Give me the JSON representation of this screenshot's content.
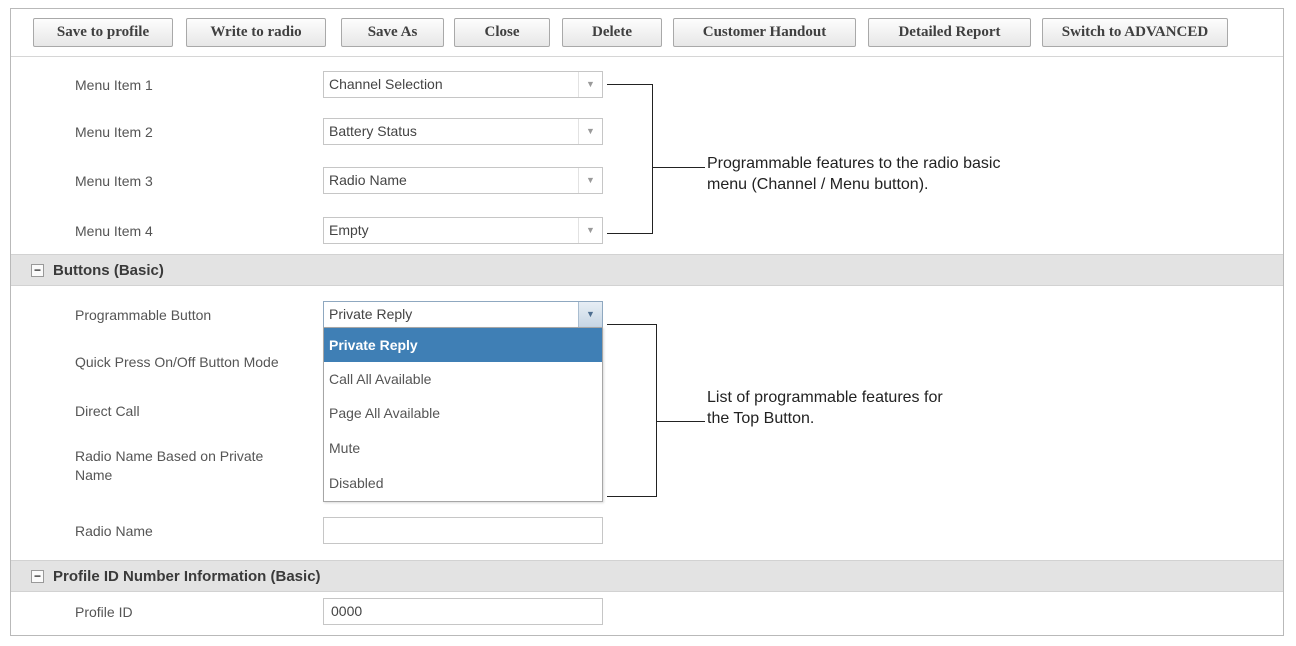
{
  "toolbar": {
    "buttons": [
      "Save to profile",
      "Write to radio",
      "Save As",
      "Close",
      "Delete",
      "Customer Handout",
      "Detailed Report",
      "Switch to ADVANCED"
    ]
  },
  "menu_items": [
    {
      "label": "Menu Item 1",
      "value": "Channel Selection"
    },
    {
      "label": "Menu Item 2",
      "value": "Battery Status"
    },
    {
      "label": "Menu Item 3",
      "value": "Radio Name"
    },
    {
      "label": "Menu Item 4",
      "value": "Empty"
    }
  ],
  "annotations": {
    "menu_line1": "Programmable features to the radio basic",
    "menu_line2": "menu (Channel / Menu button).",
    "button_line1": "List of programmable features for",
    "button_line2": "the Top Button."
  },
  "buttons_section": {
    "title": "Buttons (Basic)",
    "toggle": "−",
    "programmable_label": "Programmable Button",
    "programmable_value": "Private Reply",
    "quick_press_label": "Quick Press On/Off Button Mode",
    "direct_call_label": "Direct Call",
    "radio_name_private_label_1": "Radio Name Based on Private",
    "radio_name_private_label_2": "Name",
    "radio_name_label": "Radio Name",
    "radio_name_value": ""
  },
  "dropdown_options": [
    {
      "label": "Private Reply",
      "selected": true
    },
    {
      "label": "Call All Available",
      "selected": false
    },
    {
      "label": "Page All Available",
      "selected": false
    },
    {
      "label": "Mute",
      "selected": false
    },
    {
      "label": "Disabled",
      "selected": false
    }
  ],
  "profile_section": {
    "title": "Profile ID Number Information (Basic)",
    "toggle": "−",
    "profile_id_label": "Profile ID",
    "profile_id_value": "0000"
  },
  "icons": {
    "dropdown_arrow": "chevron-down-icon",
    "collapse": "minus-icon"
  },
  "colors": {
    "selected_option_bg": "#3f7fb5",
    "section_bg": "#e3e3e3"
  }
}
